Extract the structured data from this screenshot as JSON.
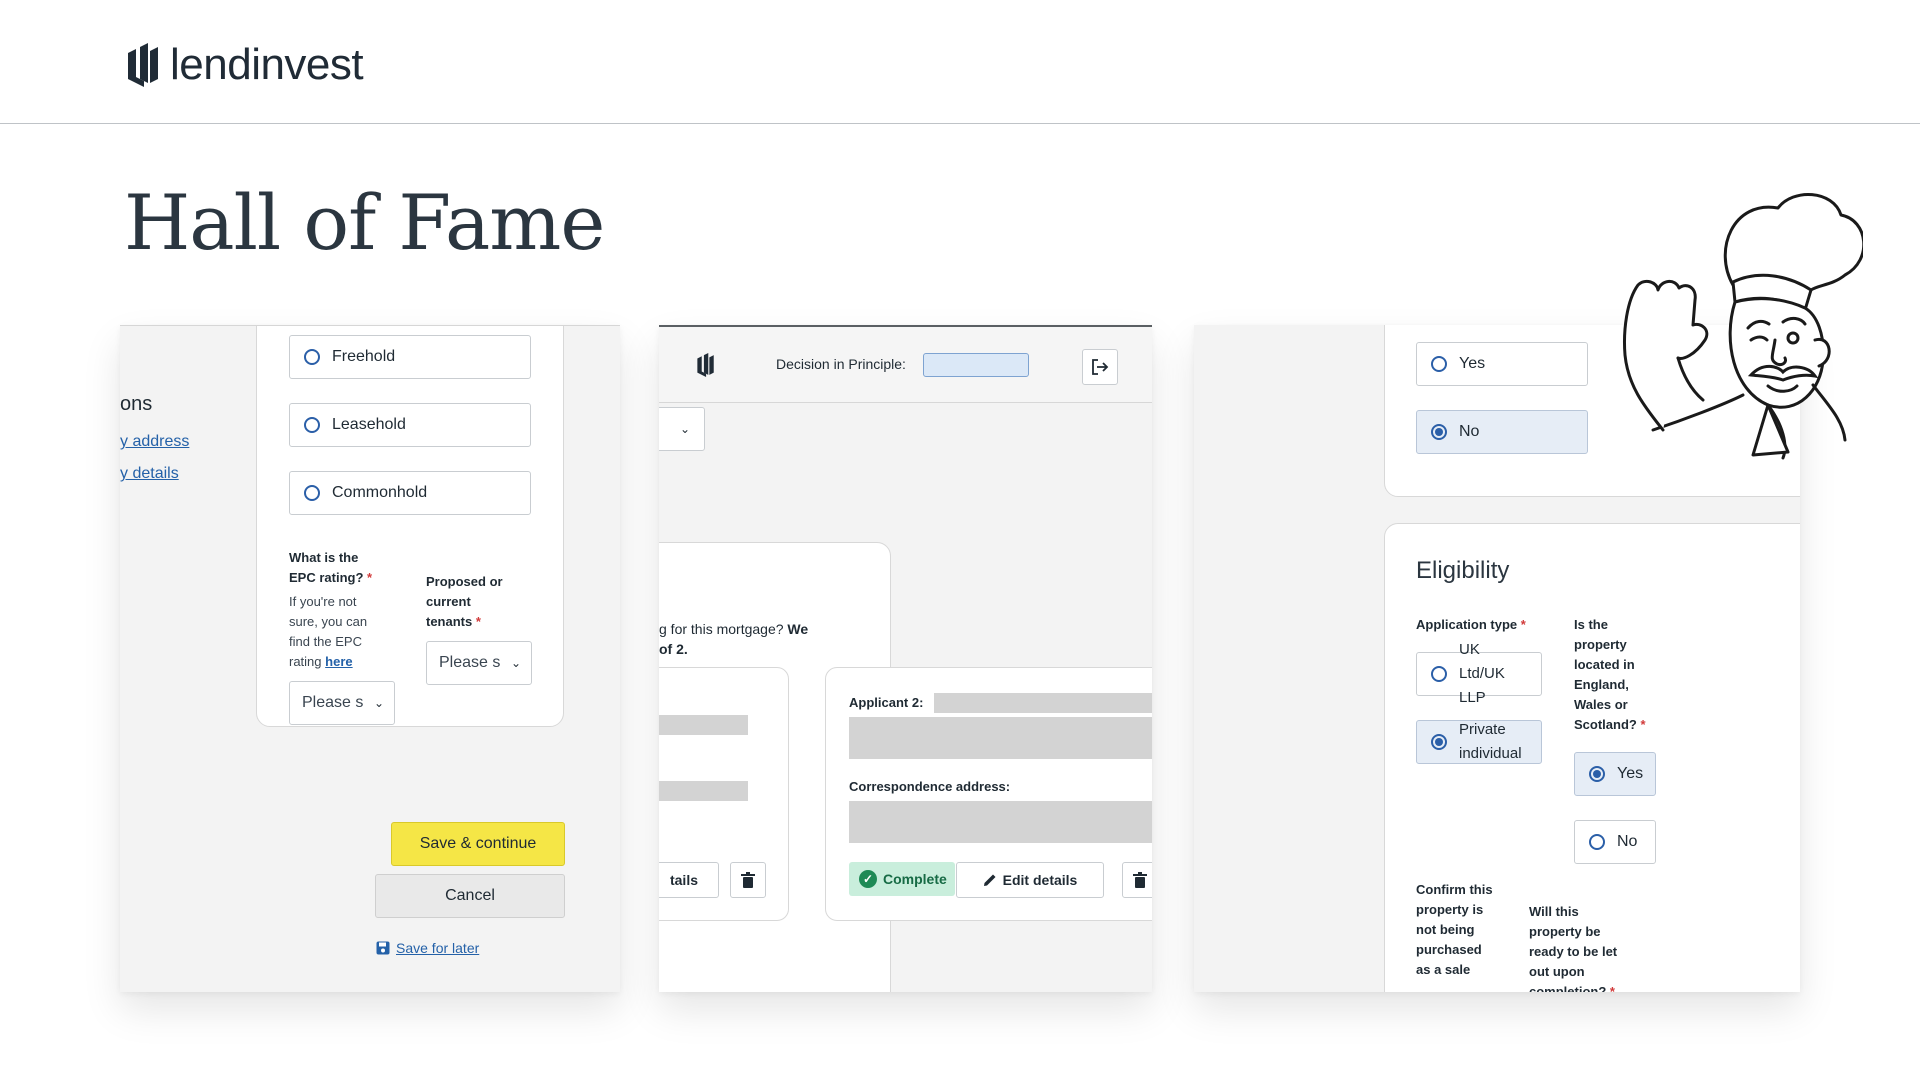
{
  "header": {
    "brand": "lendinvest"
  },
  "page": {
    "title": "Hall of Fame"
  },
  "panel1": {
    "sidebar_title": "ons",
    "sidebar_links": [
      "y address",
      "y details"
    ],
    "tenure_options": [
      "Freehold",
      "Leasehold",
      "Commonhold"
    ],
    "epc_label": "What is the EPC rating?",
    "epc_help": "If you're not sure, you can find the EPC rating",
    "epc_help_link": "here",
    "epc_select": "Please s",
    "tenants_label": "Proposed or current tenants",
    "tenants_select": "Please s",
    "required_mark": "*",
    "save_continue": "Save & continue",
    "cancel": "Cancel",
    "save_later": "Save for later"
  },
  "panel2": {
    "dip_label": "Decision in Principle:",
    "question_prefix": "g for this mortgage?",
    "question_bold_1": "We",
    "question_bold_2": "of 2.",
    "applicant2_label": "Applicant 2:",
    "correspondence_label": "Correspondence address:",
    "edit_details_partial": "tails",
    "complete_badge": "Complete",
    "edit_details": "Edit details"
  },
  "panel3": {
    "top_options": [
      {
        "label": "Yes",
        "selected": false
      },
      {
        "label": "No",
        "selected": true
      }
    ],
    "eligibility_title": "Eligibility",
    "application_type_label": "Application type",
    "application_types": [
      {
        "label": "UK Ltd/UK LLP",
        "selected": false
      },
      {
        "label": "Private individual",
        "selected": true
      }
    ],
    "location_label": "Is the property located in England, Wales or Scotland?",
    "location_options": [
      {
        "label": "Yes",
        "selected": true
      },
      {
        "label": "No",
        "selected": false
      }
    ],
    "confirm_label": "Confirm this property is not being purchased as a sale",
    "ready_label": "Will this property be ready to be let out upon completion?",
    "required_mark": "*"
  },
  "colors": {
    "accent_yellow": "#f5e646",
    "link_blue": "#2461a8",
    "complete_green": "#1e8a55"
  }
}
